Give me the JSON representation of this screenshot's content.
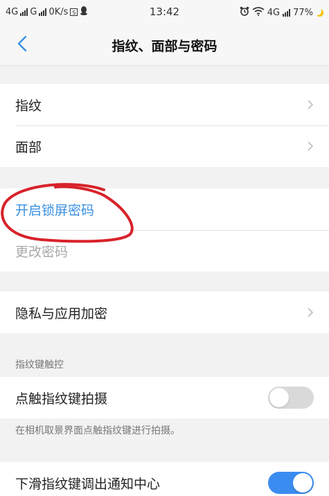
{
  "status_bar": {
    "network1": "4G",
    "network2": "G",
    "speed": "0K/s",
    "s_badge": "S",
    "time": "13:42",
    "network3": "4G",
    "battery": "77%"
  },
  "header": {
    "title": "指纹、面部与密码"
  },
  "group1": {
    "fingerprint": "指纹",
    "face": "面部"
  },
  "group2": {
    "enable_lock_password": "开启锁屏密码",
    "change_password": "更改密码"
  },
  "group3": {
    "privacy_encrypt": "隐私与应用加密"
  },
  "fingerprint_key_section": {
    "header": "指纹键触控",
    "tap_to_shoot_label": "点触指纹键拍摄",
    "tap_to_shoot_on": false,
    "tap_to_shoot_note": "在相机取景界面点触指纹键进行拍摄。",
    "swipe_notification_label": "下滑指纹键调出通知中心",
    "swipe_notification_on": true
  },
  "colors": {
    "accent": "#3a8fe0",
    "toggle_on": "#3b8cf0",
    "annotation": "#d8222a"
  }
}
